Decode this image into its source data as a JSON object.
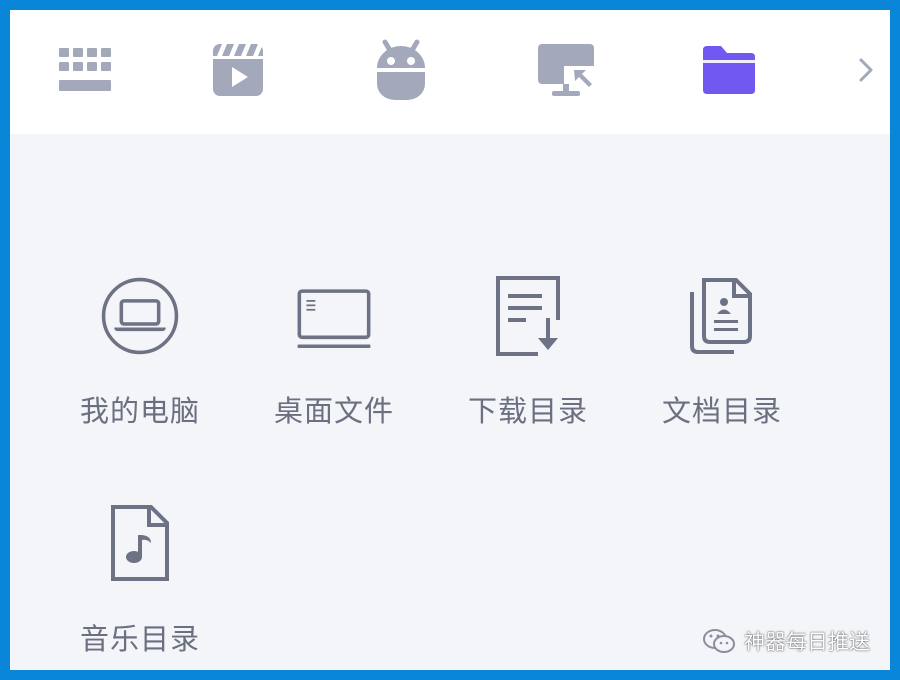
{
  "colors": {
    "border": "#0a86d8",
    "content_bg": "#f3f5f9",
    "topbar_bg": "#ffffff",
    "icon_inactive": "#a3a8bb",
    "icon_active": "#7158f0",
    "grid_icon": "#6d7385",
    "label_text": "#6a7080"
  },
  "topbar": {
    "tabs": [
      {
        "id": "keyboard",
        "icon": "keyboard-grid-icon",
        "active": false
      },
      {
        "id": "video",
        "icon": "video-clapper-icon",
        "active": false
      },
      {
        "id": "android",
        "icon": "android-icon",
        "active": false
      },
      {
        "id": "screen",
        "icon": "monitor-cast-icon",
        "active": false
      },
      {
        "id": "folder",
        "icon": "folder-icon",
        "active": true
      }
    ],
    "more_icon": "chevron-right-icon"
  },
  "folders": [
    {
      "label": "我的电脑",
      "icon": "laptop-circle-icon"
    },
    {
      "label": "桌面文件",
      "icon": "desktop-monitor-icon"
    },
    {
      "label": "下载目录",
      "icon": "download-document-icon"
    },
    {
      "label": "文档目录",
      "icon": "documents-stack-icon"
    },
    {
      "label": "音乐目录",
      "icon": "music-file-icon"
    }
  ],
  "watermark": {
    "text": "神器每日推送",
    "icon": "wechat-icon"
  }
}
